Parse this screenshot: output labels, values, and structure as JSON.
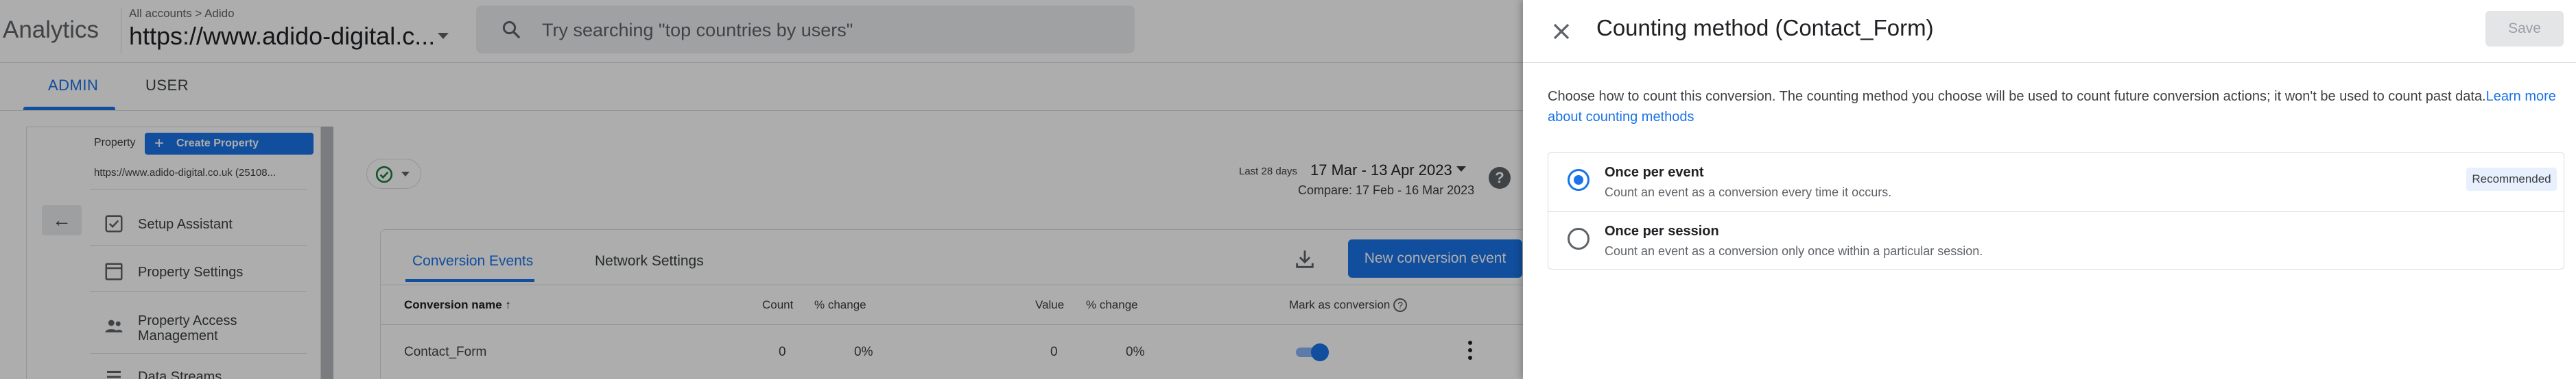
{
  "app": {
    "title": "Analytics",
    "breadcrumb": "All accounts > Adido",
    "property_selector": "https://www.adido-digital.c...",
    "search_placeholder": "Try searching \"top countries by users\""
  },
  "admin_tabs": {
    "admin": "ADMIN",
    "user": "USER"
  },
  "property_column": {
    "label": "Property",
    "create_button": "Create Property",
    "property_url": "https://www.adido-digital.co.uk (25108...",
    "menu": [
      {
        "label": "Setup Assistant",
        "icon": "checkbox-icon"
      },
      {
        "label": "Property Settings",
        "icon": "settings-page-icon"
      },
      {
        "label": "Property Access Management",
        "icon": "people-icon"
      },
      {
        "label": "Data Streams",
        "icon": "streams-icon"
      }
    ]
  },
  "date_range": {
    "label": "Last 28 days",
    "value": "17 Mar - 13 Apr 2023",
    "compare": "Compare: 17 Feb - 16 Mar 2023"
  },
  "card": {
    "tabs": [
      "Conversion Events",
      "Network Settings"
    ],
    "new_button": "New conversion event",
    "columns": {
      "name": "Conversion name",
      "count": "Count",
      "count_change": "% change",
      "value": "Value",
      "value_change": "% change",
      "mark": "Mark as conversion"
    },
    "rows": [
      {
        "name": "Contact_Form",
        "count": "0",
        "count_change": "0%",
        "value": "0",
        "value_change": "0%",
        "mark": true
      }
    ]
  },
  "panel": {
    "title": "Counting method (Contact_Form)",
    "save": "Save",
    "description": "Choose how to count this conversion. The counting method you choose will be used to count future conversion actions; it won't be used to count past data.",
    "learn_more": "Learn more about counting methods",
    "options": [
      {
        "title": "Once per event",
        "description": "Count an event as a conversion every time it occurs.",
        "badge": "Recommended",
        "selected": true
      },
      {
        "title": "Once per session",
        "description": "Count an event as a conversion only once within a particular session.",
        "badge": "",
        "selected": false
      }
    ]
  },
  "colors": {
    "accent": "#1a73e8",
    "scrim": "rgba(0,0,0,0.32)"
  }
}
